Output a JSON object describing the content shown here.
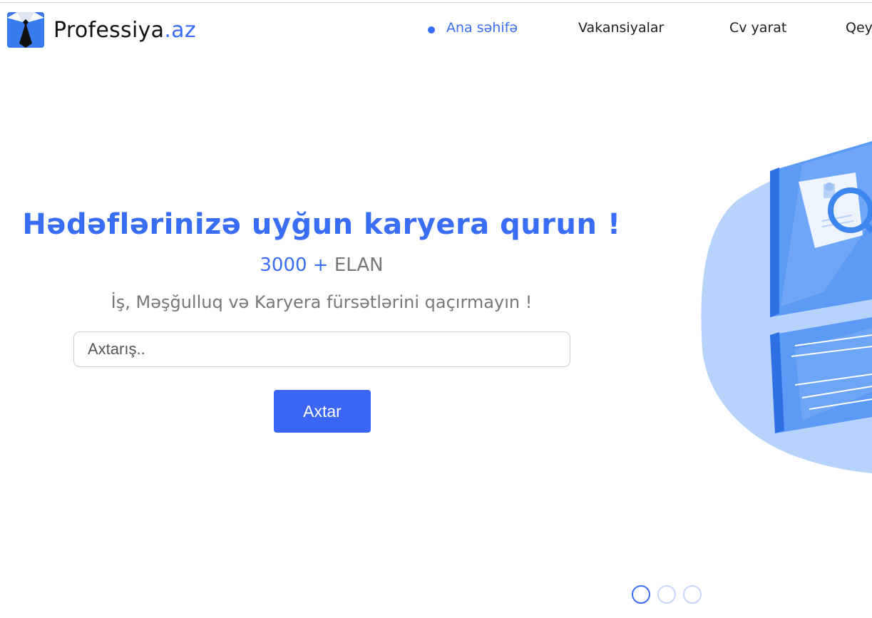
{
  "brand": {
    "name_main": "Professiya",
    "name_accent": ".az",
    "logo_icon": "suit-tie-icon",
    "accent_color": "#3a6df5"
  },
  "nav": {
    "items": [
      {
        "label": "Ana səhifə",
        "active": true
      },
      {
        "label": "Vakansiyalar",
        "active": false
      },
      {
        "label": "Cv yarat",
        "active": false
      },
      {
        "label": "Qeydiyyat",
        "active": false
      }
    ]
  },
  "hero": {
    "title": "Hədəflərinizə uyğun karyera qurun !",
    "count_number": "3000 +",
    "count_label": "ELAN",
    "subtitle": "İş, Məşğulluq və Karyera fürsətlərini qaçırmayın !"
  },
  "search": {
    "placeholder": "Axtarış..",
    "value": "",
    "button_label": "Axtar"
  },
  "carousel": {
    "slides": 3,
    "active_index": 0
  },
  "illustration": {
    "icon": "job-search-document-illustration"
  }
}
